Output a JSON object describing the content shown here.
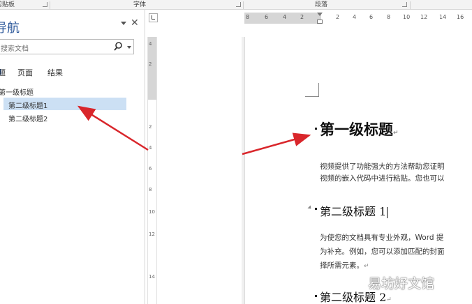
{
  "ribbon": {
    "groups": [
      "剪贴板",
      "字体",
      "段落"
    ]
  },
  "nav_pane": {
    "title": "导航",
    "search_placeholder": "搜索文档",
    "tabs": [
      "标题",
      "页面",
      "结果"
    ],
    "active_tab": "标题",
    "tree": [
      {
        "label": "第一级标题",
        "level": 1
      },
      {
        "label": "第二级标题1",
        "level": 2,
        "selected": true
      },
      {
        "label": "第二级标题2",
        "level": 2
      }
    ],
    "icons": {
      "dropdown": "chevron-down-icon",
      "close": "close-icon",
      "search": "search-icon"
    }
  },
  "rulers": {
    "vertical_numbers": [
      "4",
      "2",
      "2",
      "4",
      "6",
      "8",
      "10",
      "12",
      "14"
    ],
    "horizontal_numbers": [
      "8",
      "6",
      "4",
      "2",
      "2",
      "4",
      "6",
      "8",
      "10",
      "12",
      "14",
      "16"
    ]
  },
  "document": {
    "heading1": "第一级标题",
    "para1_line1": "视频提供了功能强大的方法帮助您证明",
    "para1_line2": "视频的嵌入代码中进行粘贴。您也可以",
    "heading2a": "第二级标题 1",
    "para2_line1": "为使您的文档具有专业外观，Word 提",
    "para2_line2": "为补充。例如，您可以添加匹配的封面",
    "para2_line3": "择所需元素。",
    "heading2b": "第二级标题 2",
    "paragraph_mark": "↵"
  },
  "watermark": "易坊好文馆",
  "colors": {
    "accent": "#2b579a",
    "selection": "#cce0f4",
    "arrow": "#d9262b"
  }
}
